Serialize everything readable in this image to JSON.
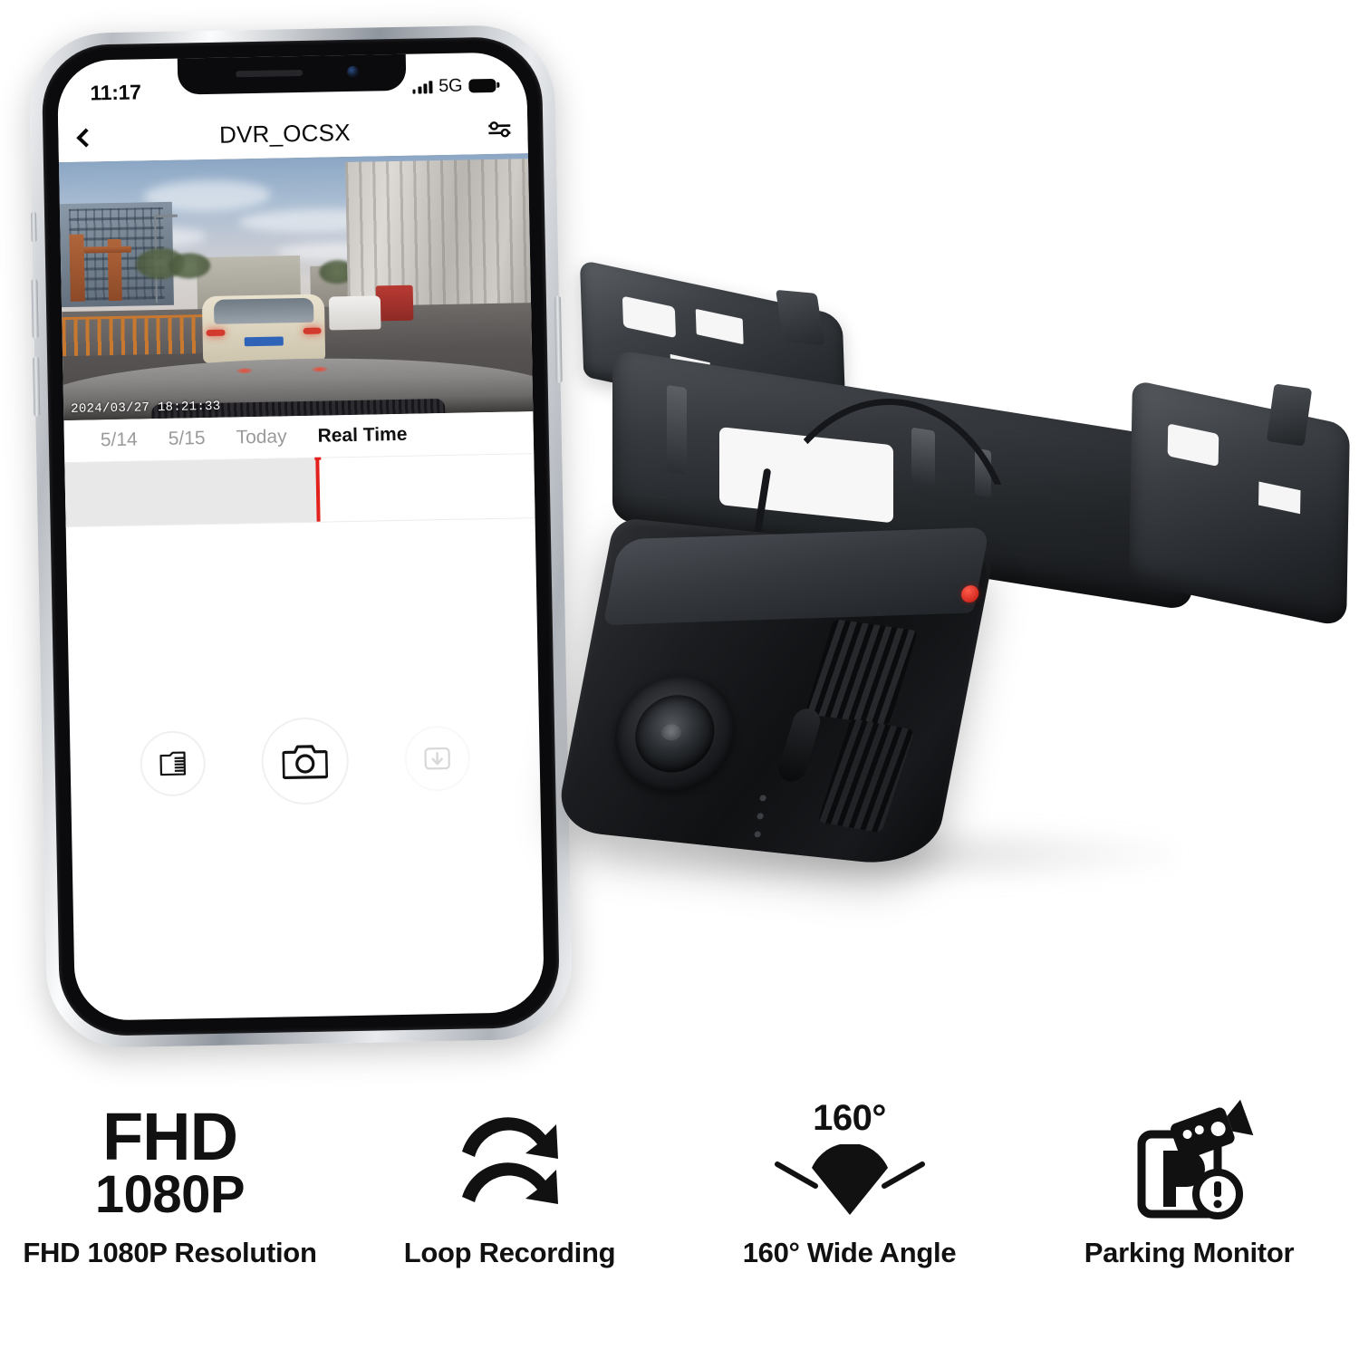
{
  "phone": {
    "status_bar": {
      "time": "11:17",
      "network": "5G",
      "signal_icon": "signal-bars-icon",
      "battery_icon": "battery-full-icon"
    },
    "header": {
      "back_icon": "chevron-left-icon",
      "title": "DVR_OCSX",
      "settings_icon": "sliders-settings-icon"
    },
    "video": {
      "timestamp": "2024/03/27 18:21:33"
    },
    "timeline": {
      "tabs": [
        {
          "label": "5/14",
          "active": false
        },
        {
          "label": "5/15",
          "active": false
        },
        {
          "label": "Today",
          "active": false
        },
        {
          "label": "Real Time",
          "active": true
        }
      ],
      "playhead_position_percent": 53.5,
      "playhead_color": "#e2211c"
    },
    "controls": [
      {
        "name": "sd-card-button",
        "icon": "sd-card-icon",
        "enabled": true
      },
      {
        "name": "capture-photo-button",
        "icon": "camera-icon",
        "enabled": true
      },
      {
        "name": "download-button",
        "icon": "download-icon",
        "enabled": false
      }
    ]
  },
  "product": {
    "name": "dash-cam-with-bracket",
    "lens_led_color": "#c0160c"
  },
  "features": [
    {
      "icon": "fhd-1080p-text-icon",
      "icon_line1": "FHD",
      "icon_line2": "1080P",
      "label": "FHD 1080P Resolution"
    },
    {
      "icon": "loop-arrows-icon",
      "label": "Loop Recording"
    },
    {
      "icon": "wide-angle-fan-icon",
      "icon_text": "160°",
      "label": "160° Wide Angle"
    },
    {
      "icon": "parking-monitor-icon",
      "label": "Parking Monitor"
    }
  ]
}
